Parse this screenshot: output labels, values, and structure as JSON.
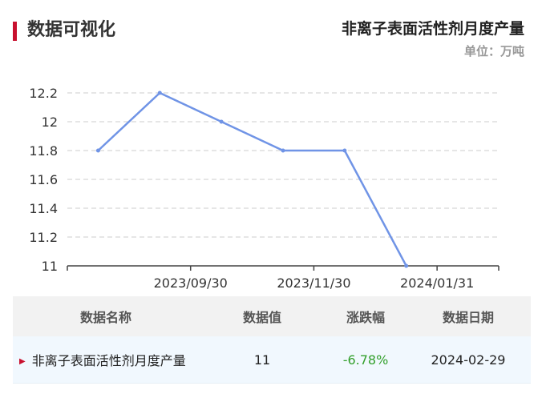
{
  "header": {
    "title": "数据可视化"
  },
  "chart_data": {
    "type": "line",
    "title": "非离子表面活性剂月度产量",
    "unit": "单位：万吨",
    "x": [
      "2023/08/31",
      "2023/09/30",
      "2023/10/31",
      "2023/11/30",
      "2023/12/31",
      "2024/01/31",
      "2024/02/29"
    ],
    "x_tick_labels": [
      "2023/09/30",
      "2023/11/30",
      "2024/01/31"
    ],
    "y_tick_labels": [
      "11",
      "11.2",
      "11.4",
      "11.6",
      "11.8",
      "12",
      "12.2"
    ],
    "series": [
      {
        "values": [
          11.8,
          12.2,
          12.0,
          11.8,
          11.8,
          11.0
        ]
      }
    ],
    "ylim": [
      11,
      12.2
    ],
    "grid": true,
    "line_color": "#7094e6"
  },
  "table": {
    "headers": [
      "数据名称",
      "数据值",
      "涨跌幅",
      "数据日期"
    ],
    "rows": [
      {
        "name": "非离子表面活性剂月度产量",
        "value": "11",
        "change": "-6.78%",
        "date": "2024-02-29",
        "direction": "down"
      }
    ]
  },
  "colors": {
    "accent": "#c8102e",
    "down": "#33a02c",
    "up": "#e03030"
  }
}
